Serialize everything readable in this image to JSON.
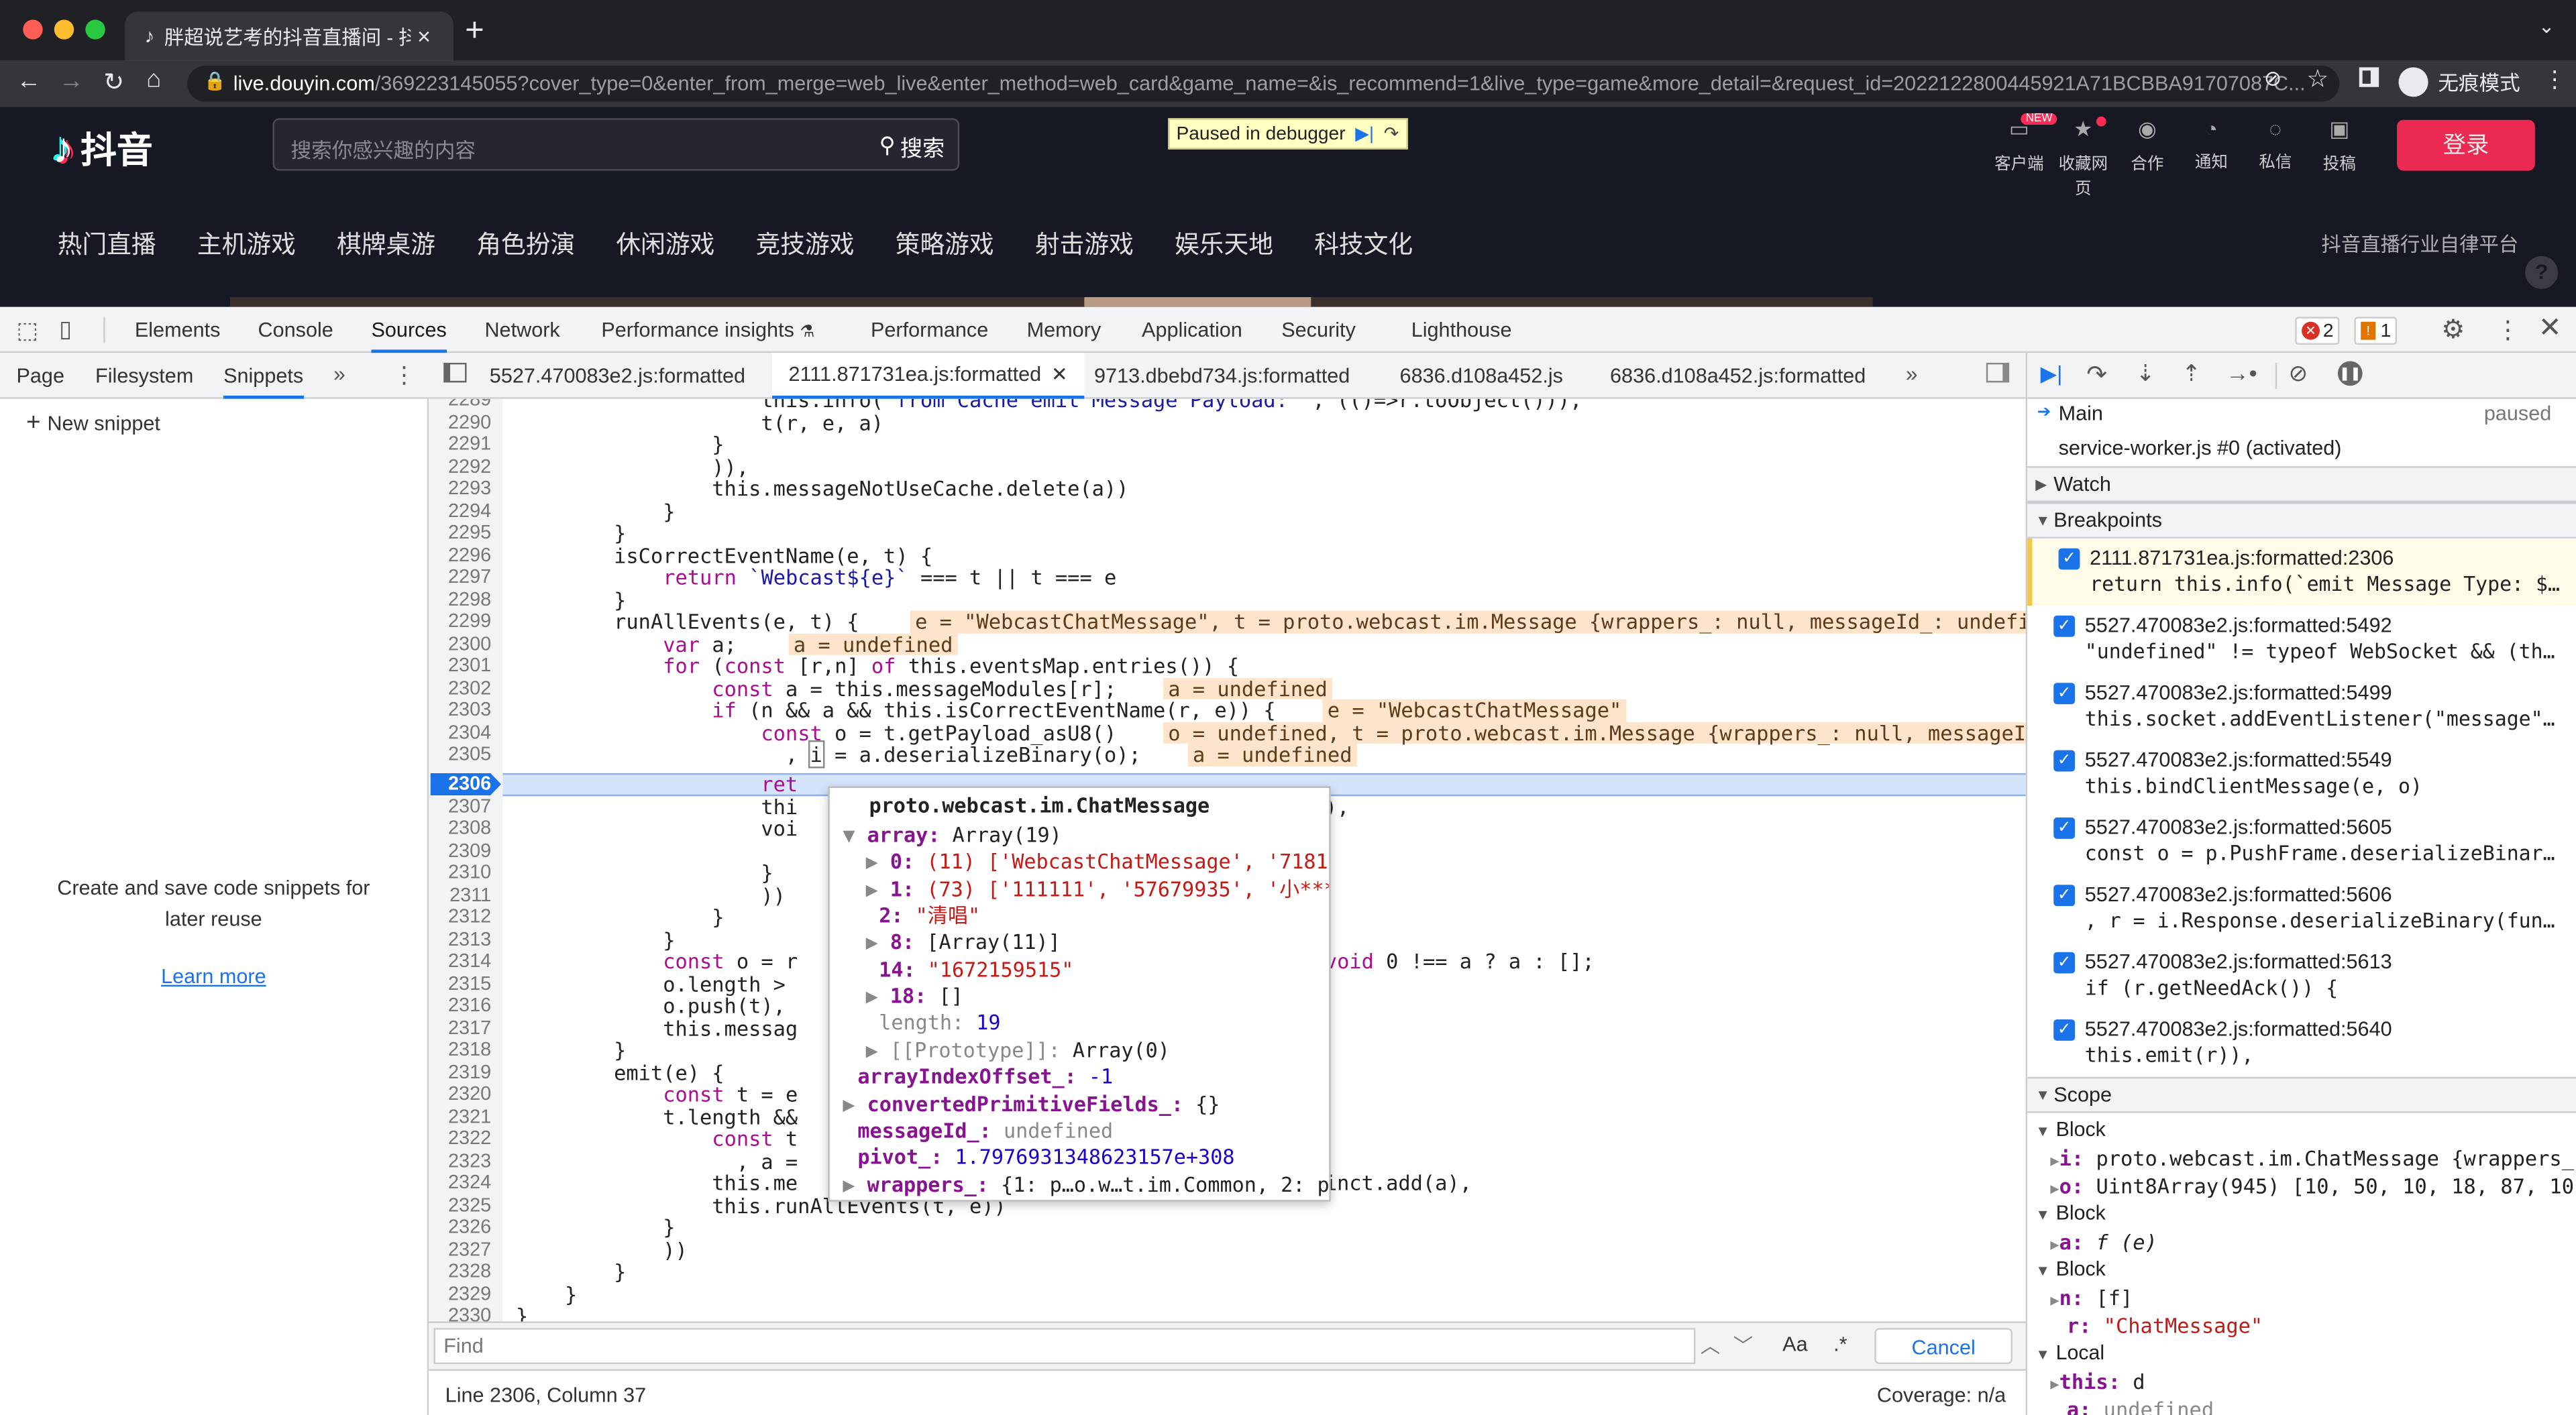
{
  "browser": {
    "tab_title": "胖超说艺考的抖音直播间 - 抖音",
    "url_host": "live.douyin.com",
    "url_rest": "/369223145055?cover_type=0&enter_from_merge=web_live&enter_method=web_card&game_name=&is_recommend=1&live_type=game&more_detail=&request_id=2022122800445921A71BCBBA91707087C...",
    "incognito_label": "无痕模式"
  },
  "site": {
    "logo_text": "抖音",
    "search_placeholder": "搜索你感兴趣的内容",
    "search_button": "搜索",
    "debug_badge": "Paused in debugger",
    "top_icons": [
      {
        "label": "客户端",
        "badge": "NEW"
      },
      {
        "label": "收藏网页"
      },
      {
        "label": "合作"
      },
      {
        "label": "通知"
      },
      {
        "label": "私信"
      },
      {
        "label": "投稿"
      }
    ],
    "login_button": "登录",
    "nav": [
      "热门直播",
      "主机游戏",
      "棋牌桌游",
      "角色扮演",
      "休闲游戏",
      "竞技游戏",
      "策略游戏",
      "射击游戏",
      "娱乐天地",
      "科技文化"
    ],
    "platform_link": "抖音直播行业自律平台",
    "help_icon": "?"
  },
  "devtools": {
    "tabs": [
      "Elements",
      "Console",
      "Sources",
      "Network",
      "Performance insights",
      "Performance",
      "Memory",
      "Application",
      "Security",
      "Lighthouse"
    ],
    "active_tab": "Sources",
    "errors": "2",
    "warnings": "1",
    "nav_tabs": [
      "Page",
      "Filesystem",
      "Snippets"
    ],
    "new_snippet": "New snippet",
    "snippets_empty": "Create and save code snippets for later reuse",
    "learn_more": "Learn more",
    "file_tabs": [
      "5527.470083e2.js:formatted",
      "2111.871731ea.js:formatted",
      "9713.dbebd734.js:formatted",
      "6836.d108a452.js",
      "6836.d108a452.js:formatted"
    ],
    "active_file": "2111.871731ea.js:formatted",
    "find_placeholder": "Find",
    "find_case": "Aa",
    "find_regex": ".*",
    "find_cancel": "Cancel",
    "status_pos": "Line 2306, Column 37",
    "status_cov": "Coverage: n/a"
  },
  "code": {
    "line_numbers": [
      "2289",
      "2290",
      "2291",
      "2292",
      "2293",
      "2294",
      "2295",
      "2296",
      "2297",
      "2298",
      "2299",
      "2300",
      "2301",
      "2302",
      "2303",
      "2304",
      "2305",
      "2306",
      "2307",
      "2308",
      "2309",
      "2310",
      "2311",
      "2312",
      "2313",
      "2314",
      "2315",
      "2316",
      "2317",
      "2318",
      "2319",
      "2320",
      "2321",
      "2322",
      "2323",
      "2324",
      "2325",
      "2326",
      "2327",
      "2328",
      "2329",
      "2330"
    ],
    "current_line": "2306",
    "annotations": {
      "a2299": "e = \"WebcastChatMessage\", t = proto.webcast.im.Message {wrappers_: null, messageId_: undefin",
      "a2300": "a = undefined",
      "a2302": "a = undefined",
      "a2303": "e = \"WebcastChatMessage\"",
      "a2304": "o = undefined, t = proto.webcast.im.Message {wrappers_: null, messageIc",
      "a2305": "a = undefined"
    }
  },
  "popover": {
    "title": "proto.webcast.im.ChatMessage",
    "rows": [
      {
        "k": "array",
        "v": "Array(19)"
      },
      {
        "k": "0:",
        "v": "(11) ['WebcastChatMessage', '71818"
      },
      {
        "k": "1:",
        "v": "(73) ['111111', '57679935', '小***"
      },
      {
        "k": "2:",
        "v": "\"清唱\""
      },
      {
        "k": "8:",
        "v": "[Array(11)]"
      },
      {
        "k": "14:",
        "v": "\"1672159515\""
      },
      {
        "k": "18:",
        "v": "[]"
      },
      {
        "k": "length:",
        "v": "19"
      },
      {
        "k": "[[Prototype]]:",
        "v": "Array(0)"
      },
      {
        "k": "arrayIndexOffset_:",
        "v": "-1"
      },
      {
        "k": "convertedPrimitiveFields_:",
        "v": "{}"
      },
      {
        "k": "messageId_:",
        "v": "undefined"
      },
      {
        "k": "pivot_:",
        "v": "1.7976931348623157e+308"
      },
      {
        "k": "wrappers_:",
        "v": "{1: p…o.w…t.im.Common, 2: p"
      }
    ]
  },
  "debugger": {
    "thread_main": "Main",
    "thread_status": "paused",
    "thread_sw": "service-worker.js #0 (activated)",
    "watch": "Watch",
    "breakpoints_title": "Breakpoints",
    "breakpoints": [
      {
        "loc": "2111.871731ea.js:formatted:2306",
        "code": "return this.info(`emit Message Type: $…"
      },
      {
        "loc": "5527.470083e2.js:formatted:5492",
        "code": "\"undefined\" != typeof WebSocket && (th…"
      },
      {
        "loc": "5527.470083e2.js:formatted:5499",
        "code": "this.socket.addEventListener(\"message\"…"
      },
      {
        "loc": "5527.470083e2.js:formatted:5549",
        "code": "this.bindClientMessage(e, o)"
      },
      {
        "loc": "5527.470083e2.js:formatted:5605",
        "code": "const o = p.PushFrame.deserializeBinar…"
      },
      {
        "loc": "5527.470083e2.js:formatted:5606",
        "code": ", r = i.Response.deserializeBinary(fun…"
      },
      {
        "loc": "5527.470083e2.js:formatted:5613",
        "code": "if (r.getNeedAck()) {"
      },
      {
        "loc": "5527.470083e2.js:formatted:5640",
        "code": "this.emit(r)),"
      }
    ],
    "scope_title": "Scope",
    "block": "Block",
    "local": "Local",
    "scope": {
      "i_key": "i:",
      "i_val": "proto.webcast.im.ChatMessage {wrappers_",
      "o_key": "o:",
      "o_val": "Uint8Array(945) [10, 50, 10, 18, 87, 10",
      "a_key": "a:",
      "a_val": "f (e)",
      "n_key": "n:",
      "n_val": "[f]",
      "r_key": "r:",
      "r_val": "\"ChatMessage\"",
      "this_key": "this:",
      "this_val": "d",
      "la_key": "a:",
      "la_val": "undefined"
    }
  }
}
